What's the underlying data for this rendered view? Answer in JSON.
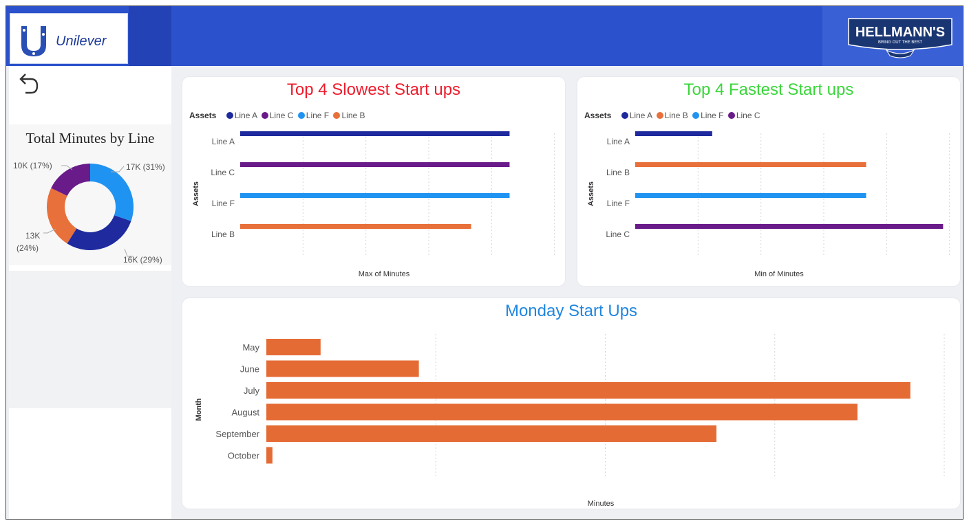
{
  "header": {
    "left_logo": "Unilever",
    "right_logo": "HELLMANN'S",
    "right_logo_tagline": "BRING OUT THE BEST"
  },
  "nav": {
    "back_icon": "undo-arrow-icon"
  },
  "donut": {
    "title": "Total Minutes by Line",
    "labels": [
      "17K (31%)",
      "16K (29%)",
      "13K (24%)",
      "10K (17%)"
    ]
  },
  "colors": {
    "line_a": "#1e2a9e",
    "line_b": "#e8703a",
    "line_c": "#6a1b8a",
    "line_f": "#1f93f2",
    "bar": "#e56b35",
    "header": "#2b52cc"
  },
  "slowest": {
    "title": "Top 4 Slowest Start ups",
    "title_color": "#ee1c2c",
    "legend_title": "Assets",
    "legend": [
      "Line A",
      "Line C",
      "Line F",
      "Line B"
    ],
    "ylabel": "Assets",
    "xlabel": "Max of Minutes"
  },
  "fastest": {
    "title": "Top 4 Fastest Start ups",
    "title_color": "#3bd63b",
    "legend_title": "Assets",
    "legend": [
      "Line A",
      "Line B",
      "Line F",
      "Line C"
    ],
    "ylabel": "Assets",
    "xlabel": "Min of Minutes"
  },
  "monday": {
    "title": "Monday Start Ups",
    "title_color": "#1f86e0",
    "ylabel": "Month",
    "xlabel": "Minutes"
  },
  "chart_data": [
    {
      "type": "pie",
      "title": "Total Minutes by Line",
      "categories": [
        "Line F",
        "Line A",
        "Line B",
        "Line C"
      ],
      "values": [
        17,
        16,
        13,
        10
      ],
      "labels": [
        "17K (31%)",
        "16K (29%)",
        "13K (24%)",
        "10K (17%)"
      ],
      "colors": [
        "#1f93f2",
        "#1e2a9e",
        "#e8703a",
        "#6a1b8a"
      ]
    },
    {
      "type": "bar",
      "title": "Top 4 Slowest Start ups",
      "categories": [
        "Line A",
        "Line C",
        "Line F",
        "Line B"
      ],
      "values": [
        0.84,
        0.84,
        0.84,
        0.72
      ],
      "xlim": [
        0,
        1
      ],
      "xlabel": "Max of Minutes",
      "ylabel": "Assets",
      "legend": "top-left"
    },
    {
      "type": "bar",
      "title": "Top 4 Fastest Start ups",
      "categories": [
        "Line A",
        "Line B",
        "Line F",
        "Line C"
      ],
      "values": [
        0.24,
        0.72,
        0.72,
        0.96
      ],
      "xlim": [
        0,
        1
      ],
      "xlabel": "Min of Minutes",
      "ylabel": "Assets",
      "legend": "top-left"
    },
    {
      "type": "bar",
      "title": "Monday Start Ups",
      "categories": [
        "May",
        "June",
        "July",
        "August",
        "September",
        "October"
      ],
      "values": [
        0.08,
        0.225,
        0.95,
        0.872,
        0.664,
        0.009
      ],
      "xlim": [
        0,
        1
      ],
      "xlabel": "Minutes",
      "ylabel": "Month"
    }
  ]
}
